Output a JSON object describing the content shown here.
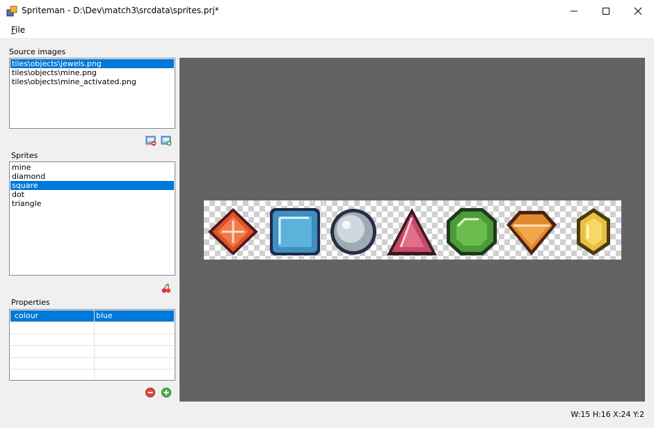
{
  "window": {
    "title": "Spriteman - D:\\Dev\\match3\\srcdata\\sprites.prj*",
    "app_icon": "spriteman-app-icon",
    "controls": [
      "minimize-icon",
      "maximize-icon",
      "close-icon"
    ]
  },
  "menu": {
    "file_label": "File"
  },
  "source_images": {
    "label": "Source images",
    "items": [
      {
        "label": "tiles\\objects\\jewels.png",
        "selected": true
      },
      {
        "label": "tiles\\objects\\mine.png",
        "selected": false
      },
      {
        "label": "tiles\\objects\\mine_activated.png",
        "selected": false
      }
    ],
    "buttons": [
      "remove-image-icon",
      "add-image-icon"
    ]
  },
  "sprites": {
    "label": "Sprites",
    "items": [
      {
        "label": "mine",
        "selected": false
      },
      {
        "label": "diamond",
        "selected": false
      },
      {
        "label": "square",
        "selected": true
      },
      {
        "label": "dot",
        "selected": false
      },
      {
        "label": "triangle",
        "selected": false
      }
    ],
    "buttons": [
      "cherries-icon"
    ]
  },
  "properties": {
    "label": "Properties",
    "rows": [
      {
        "key": "colour",
        "value": "blue",
        "selected": true
      },
      {
        "key": "",
        "value": "",
        "selected": false
      },
      {
        "key": "",
        "value": "",
        "selected": false
      },
      {
        "key": "",
        "value": "",
        "selected": false
      },
      {
        "key": "",
        "value": "",
        "selected": false
      },
      {
        "key": "",
        "value": "",
        "selected": false
      }
    ],
    "buttons": [
      "remove-property-icon",
      "add-property-icon"
    ]
  },
  "canvas": {
    "background": "#636363",
    "gems": [
      {
        "icon": "red-diamond-gem-icon",
        "color": "#e0502a"
      },
      {
        "icon": "blue-square-gem-icon",
        "color": "#3f8fc0"
      },
      {
        "icon": "white-dot-gem-icon",
        "color": "#b8c4cc"
      },
      {
        "icon": "pink-triangle-gem-icon",
        "color": "#c84a6a"
      },
      {
        "icon": "green-octagon-gem-icon",
        "color": "#4e9a3a"
      },
      {
        "icon": "orange-diamond-gem-icon",
        "color": "#e08a30"
      },
      {
        "icon": "yellow-gem-icon",
        "color": "#e8c040"
      }
    ],
    "selected_sprite": "square"
  },
  "status": {
    "text": "W:15 H:16 X:24 Y:2"
  },
  "colors": {
    "selection": "#0078d7"
  }
}
